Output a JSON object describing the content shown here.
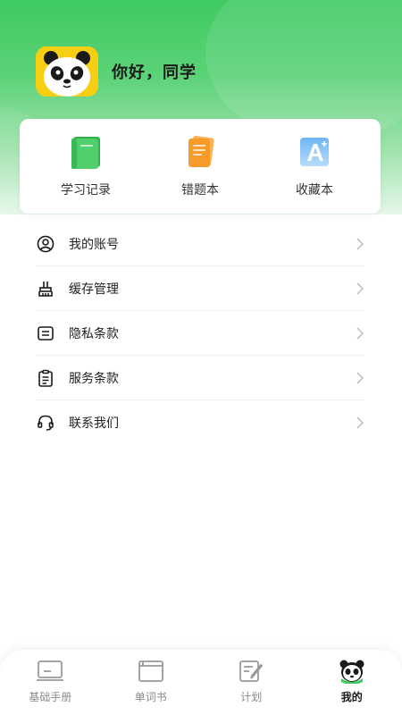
{
  "profile": {
    "greeting": "你好，同学",
    "avatar_icon": "panda-avatar-icon"
  },
  "quick_actions": [
    {
      "label": "学习记录",
      "icon": "green-book-icon",
      "color": "#3cc35a"
    },
    {
      "label": "错题本",
      "icon": "orange-notebook-icon",
      "color": "#f59a2b"
    },
    {
      "label": "收藏本",
      "icon": "blue-letter-a-icon",
      "color": "#5aa7f0"
    }
  ],
  "menu": [
    {
      "label": "我的账号",
      "icon": "user-circle-icon"
    },
    {
      "label": "缓存管理",
      "icon": "broom-icon"
    },
    {
      "label": "隐私条款",
      "icon": "document-lines-icon"
    },
    {
      "label": "服务条款",
      "icon": "clipboard-icon"
    },
    {
      "label": "联系我们",
      "icon": "headset-icon"
    }
  ],
  "tabbar": [
    {
      "label": "基础手册",
      "icon": "manual-icon",
      "active": false
    },
    {
      "label": "单词书",
      "icon": "wordbook-icon",
      "active": false
    },
    {
      "label": "计划",
      "icon": "plan-icon",
      "active": false
    },
    {
      "label": "我的",
      "icon": "panda-tab-icon",
      "active": true
    }
  ],
  "colors": {
    "brand_green": "#3fca62",
    "text_primary": "#1a1a1a",
    "text_secondary": "#8a8a8a",
    "avatar_yellow": "#f6cf12"
  }
}
